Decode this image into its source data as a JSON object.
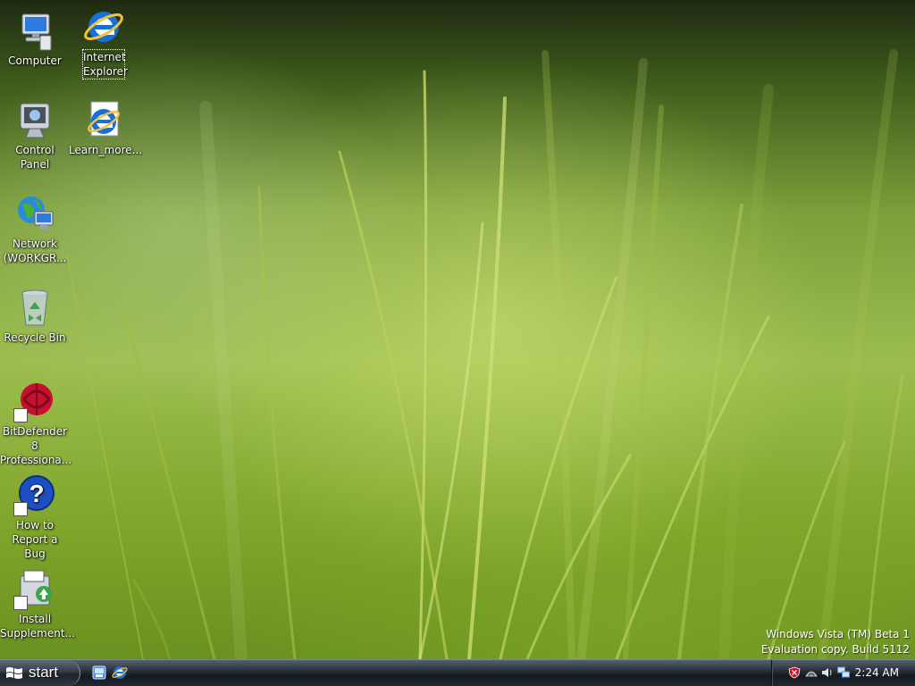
{
  "desktop": {
    "icons": [
      {
        "name": "computer",
        "label": "Computer",
        "icon": "computer-icon"
      },
      {
        "name": "internet-explorer",
        "label": "Internet\nExplorer",
        "icon": "internet-explorer-icon"
      },
      {
        "name": "control-panel",
        "label": "Control Panel",
        "icon": "control-panel-icon"
      },
      {
        "name": "learn-more",
        "label": "Learn_more...",
        "icon": "internet-explorer-icon"
      },
      {
        "name": "network",
        "label": "Network\n(WORKGR...",
        "icon": "network-icon"
      },
      {
        "name": "recycle-bin",
        "label": "Recycle Bin",
        "icon": "recycle-bin-icon"
      },
      {
        "name": "bitdefender",
        "label": "BitDefender 8\nProfessiona...",
        "icon": "bitdefender-icon"
      },
      {
        "name": "report-bug",
        "label": "How to\nReport a Bug",
        "icon": "help-icon"
      },
      {
        "name": "install-supplement",
        "label": "Install\nSupplement...",
        "icon": "installer-icon"
      }
    ],
    "watermark": {
      "line1": "Windows Vista (TM) Beta 1",
      "line2": "Evaluation copy. Build 5112"
    }
  },
  "taskbar": {
    "start_label": "start",
    "quick_launch": [
      "show-desktop-icon",
      "internet-explorer-icon"
    ],
    "tray_icons": [
      "security-center-icon",
      "bitdefender-tray-icon",
      "volume-icon",
      "network-tray-icon"
    ],
    "clock": "2:24 AM"
  },
  "colors": {
    "taskbar": "#1e242c",
    "start_button": "#2f3743",
    "security_red": "#c8102e",
    "ie_blue": "#1a6fd6"
  }
}
